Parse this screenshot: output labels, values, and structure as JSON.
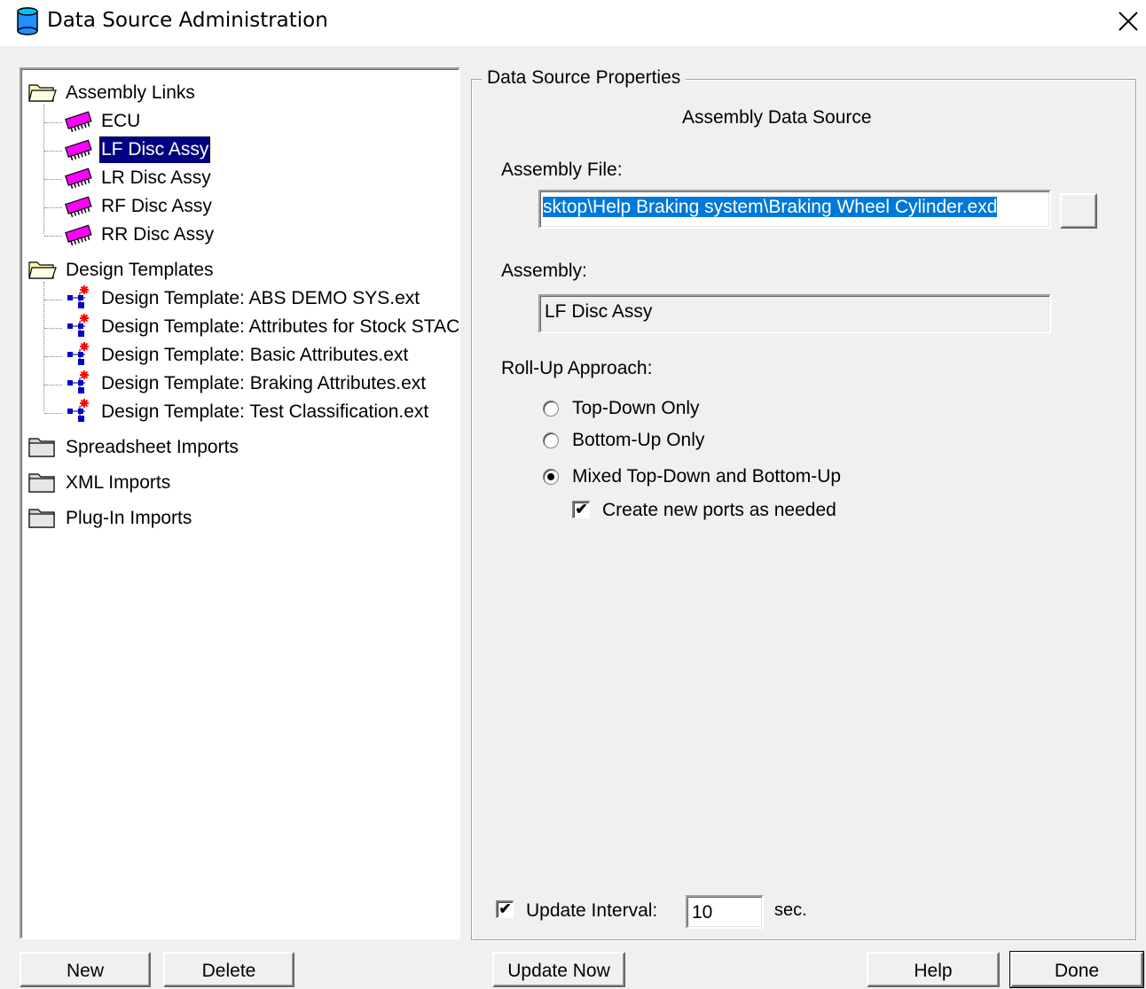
{
  "window": {
    "title": "Data Source Administration",
    "close_icon": "close-icon"
  },
  "tree": {
    "groups": [
      {
        "label": "Assembly Links",
        "expanded": true,
        "children": [
          "ECU",
          "LF Disc Assy",
          "LR Disc Assy",
          "RF Disc Assy",
          "RR Disc Assy"
        ],
        "selected": "LF Disc Assy"
      },
      {
        "label": "Design Templates",
        "expanded": true,
        "children": [
          "Design Template: ABS DEMO SYS.ext",
          "Design Template: Attributes for Stock STAC",
          "Design Template: Basic Attributes.ext",
          "Design Template: Braking Attributes.ext",
          "Design Template: Test Classification.ext"
        ]
      },
      {
        "label": "Spreadsheet Imports",
        "expanded": false,
        "children": []
      },
      {
        "label": "XML Imports",
        "expanded": false,
        "children": []
      },
      {
        "label": "Plug-In Imports",
        "expanded": false,
        "children": []
      }
    ]
  },
  "properties": {
    "group_title": "Data Source Properties",
    "subtitle": "Assembly Data Source",
    "assembly_file_label": "Assembly File:",
    "assembly_file_value": "sktop\\Help Braking system\\Braking Wheel Cylinder.exd",
    "browse_label": "",
    "assembly_label": "Assembly:",
    "assembly_value": "LF Disc Assy",
    "rollup_label": "Roll-Up Approach:",
    "rollup_options": [
      "Top-Down Only",
      "Bottom-Up Only",
      "Mixed Top-Down and Bottom-Up"
    ],
    "rollup_selected": 2,
    "create_ports_label": "Create new ports as needed",
    "create_ports_checked": true,
    "update_interval_label": "Update Interval:",
    "update_interval_checked": true,
    "update_interval_value": "10",
    "update_interval_unit": "sec."
  },
  "buttons": {
    "new": "New",
    "delete": "Delete",
    "update_now": "Update Now",
    "help": "Help",
    "done": "Done"
  },
  "colors": {
    "selection": "#000080",
    "text_selection": "#0078d7",
    "chip_icon": "#ff00ff",
    "db_icon": "#1e90ff"
  }
}
